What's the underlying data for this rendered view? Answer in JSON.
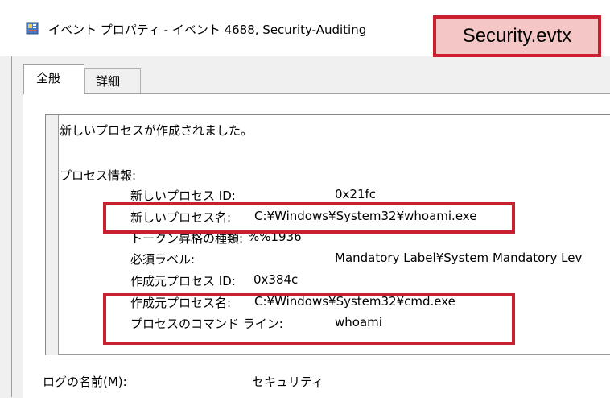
{
  "window": {
    "title": "イベント プロパティ - イベント 4688, Security-Auditing",
    "icon": "event-viewer-icon"
  },
  "callout": {
    "text": "Security.evtx"
  },
  "tabs": [
    {
      "label": "全般",
      "selected": true
    },
    {
      "label": "詳細",
      "selected": false
    }
  ],
  "description": {
    "headline": "新しいプロセスが作成されました。",
    "section_title": "プロセス情報:",
    "fields": [
      {
        "label": "新しいプロセス ID:",
        "value": "0x21fc"
      },
      {
        "label": "新しいプロセス名:",
        "value": "C:¥Windows¥System32¥whoami.exe"
      },
      {
        "label": "トークン昇格の種類:",
        "value": "%%1936"
      },
      {
        "label": "必須ラベル:",
        "value": "Mandatory Label¥System Mandatory Lev"
      },
      {
        "label": "作成元プロセス ID:",
        "value": "0x384c"
      },
      {
        "label": "作成元プロセス名:",
        "value": "C:¥Windows¥System32¥cmd.exe"
      },
      {
        "label": "プロセスのコマンド ライン:",
        "value": "whoami"
      }
    ]
  },
  "log_name": {
    "label": "ログの名前(M):",
    "value": "セキュリティ"
  },
  "colors": {
    "highlight": "#c8202e",
    "callout_fill": "#f4c6c6"
  }
}
